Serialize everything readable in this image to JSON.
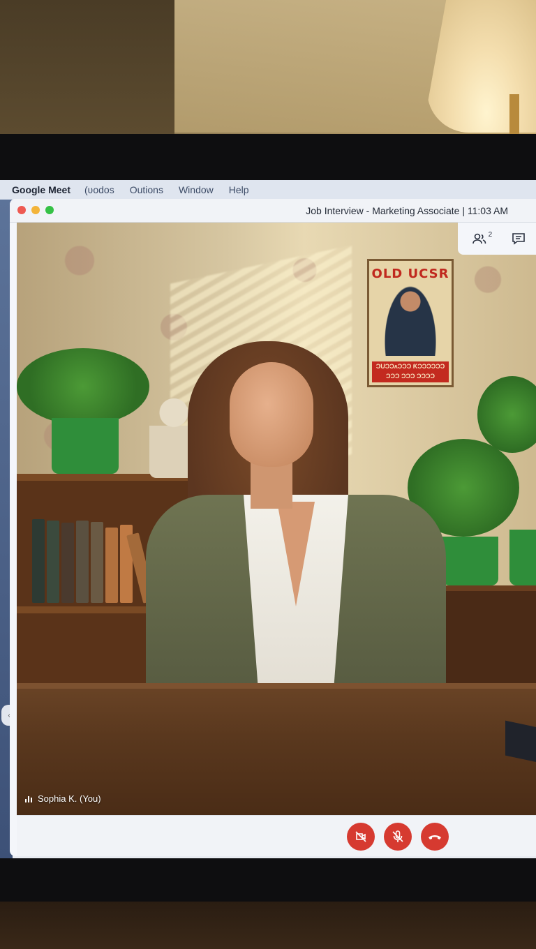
{
  "menubar": {
    "app_name": "Google Meet",
    "items": [
      "(ʋodos",
      "Outions",
      "Window",
      "Help"
    ]
  },
  "window": {
    "title": "Job Interview - Marketing Associate | 11:03 AM"
  },
  "participants": {
    "count": "2",
    "icon": "people-icon",
    "chat_icon": "chat-icon"
  },
  "video": {
    "poster_title": "OLD UCSR",
    "poster_subtitle": "ƆUƆƆʌƆƆƆ ƘƆƆƆƆƆƆ\nƆƆƆ ƆƆƆ ƆƆƆƆ",
    "name_tag": "Sophia K. (You)"
  },
  "controls": {
    "video_off_icon": "camera-off-icon",
    "mic_off_icon": "mic-off-icon",
    "end_call_icon": "end-call-icon",
    "accent": "#d63a30"
  }
}
